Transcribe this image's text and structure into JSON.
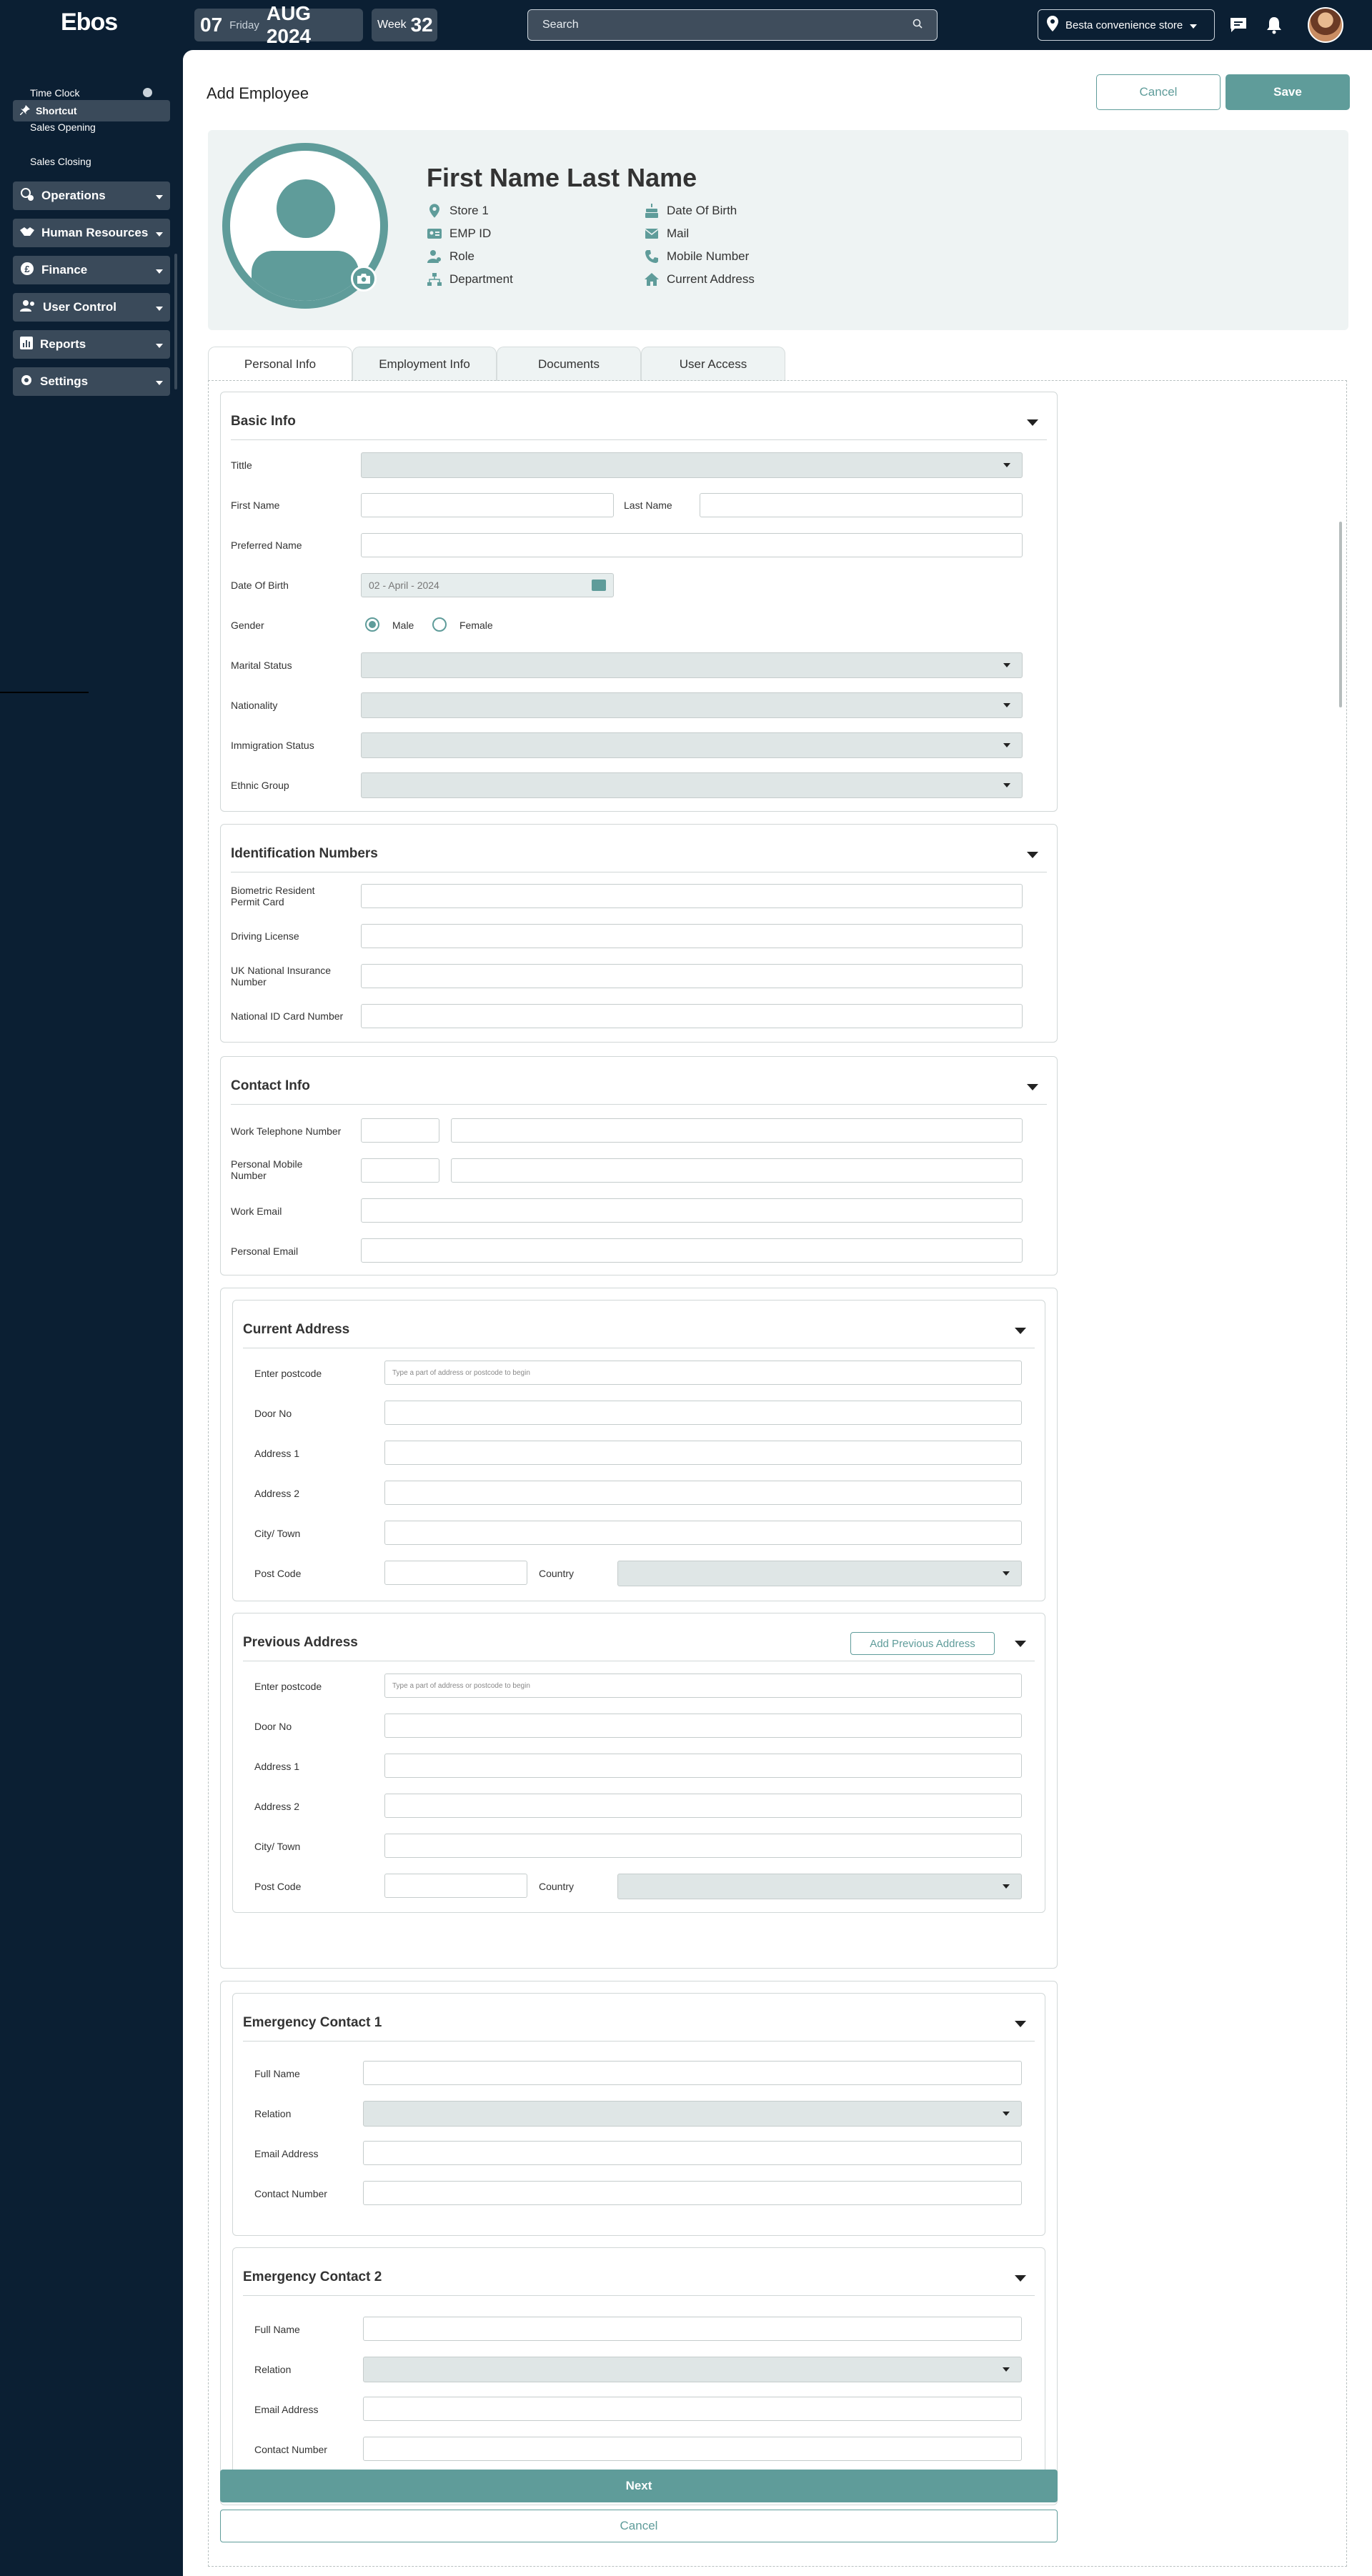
{
  "app": {
    "logo": "Ebos"
  },
  "topbar": {
    "day": "07",
    "weekday": "Friday",
    "month_year": "AUG 2024",
    "week_label": "Week",
    "week_num": "32",
    "search_placeholder": "Search",
    "store": "Besta convenience store"
  },
  "sidebar": {
    "shortcut_label": "Shortcut",
    "shortcuts": [
      "Time Clock",
      "Sales Opening",
      "Sales Closing"
    ],
    "items": [
      "Operations",
      "Human Resources",
      "Finance",
      "User Control",
      "Reports",
      "Settings"
    ]
  },
  "page": {
    "title": "Add Employee",
    "cancel": "Cancel",
    "save": "Save"
  },
  "profile": {
    "name": "First Name Last Name",
    "left_fields": [
      "Store 1",
      "EMP ID",
      "Role",
      "Department"
    ],
    "right_fields": [
      "Date Of Birth",
      "Mail",
      "Mobile Number",
      "Current Address"
    ]
  },
  "tabs": [
    "Personal Info",
    "Employment Info",
    "Documents",
    "User Access"
  ],
  "basic_info": {
    "title": "Basic Info",
    "tittle": "Tittle",
    "first_name": "First Name",
    "last_name": "Last Name",
    "preferred_name": "Preferred Name",
    "dob": "Date Of Birth",
    "dob_value": "02 - April - 2024",
    "gender": "Gender",
    "male": "Male",
    "female": "Female",
    "marital": "Marital Status",
    "nationality": "Nationality",
    "immigration": "Immigration Status",
    "ethnic": "Ethnic Group"
  },
  "identification": {
    "title": "Identification Numbers",
    "brp": "Biometric Resident Permit Card",
    "driving": "Driving License",
    "ni": "UK National Insurance Number",
    "national_id": "National ID Card Number"
  },
  "contact": {
    "title": "Contact Info",
    "work_phone": "Work Telephone Number",
    "personal_mobile": "Personal Mobile Number",
    "work_email": "Work Email",
    "personal_email": "Personal Email"
  },
  "current_address": {
    "title": "Current Address",
    "postcode": "Enter postcode",
    "postcode_placeholder": "Type a part of address or postcode to begin",
    "door": "Door No",
    "address1": "Address 1",
    "address2": "Address 2",
    "city": "City/ Town",
    "post_code": "Post Code",
    "country": "Country"
  },
  "previous_address": {
    "title": "Previous Address",
    "add_button": "Add Previous Address",
    "postcode": "Enter postcode",
    "postcode_placeholder": "Type a part of address or postcode to begin",
    "door": "Door No",
    "address1": "Address 1",
    "address2": "Address 2",
    "city": "City/ Town",
    "post_code": "Post Code",
    "country": "Country"
  },
  "emergency1": {
    "title": "Emergency Contact 1",
    "full_name": "Full Name",
    "relation": "Relation",
    "email": "Email Address",
    "contact": "Contact Number"
  },
  "emergency2": {
    "title": "Emergency Contact 2",
    "full_name": "Full Name",
    "relation": "Relation",
    "email": "Email Address",
    "contact": "Contact Number"
  },
  "footer": {
    "next": "Next",
    "cancel": "Cancel"
  },
  "colors": {
    "accent": "#5f9c9a",
    "sidebar_bg": "#0b1f33",
    "card_bg": "#eef3f3"
  }
}
